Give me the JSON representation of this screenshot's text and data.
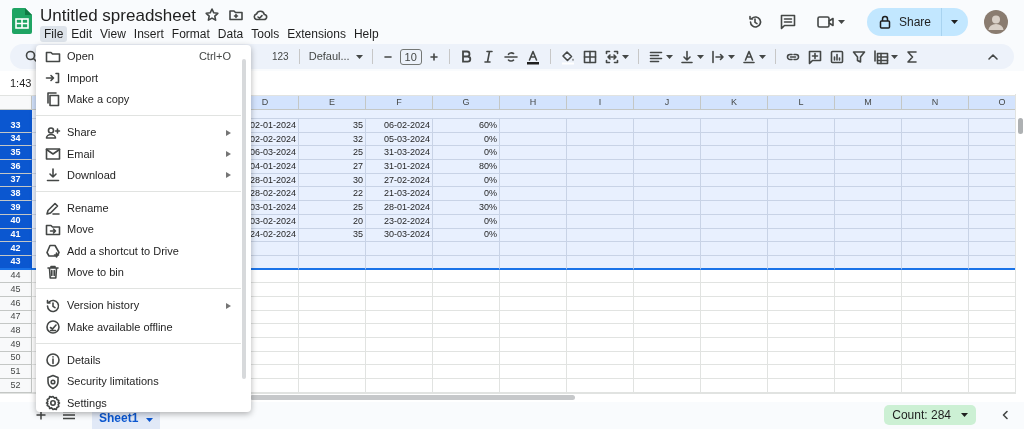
{
  "title": "Untitled spreadsheet",
  "menu_bar": [
    {
      "label": "File",
      "selected": true
    },
    {
      "label": "Edit",
      "selected": false
    },
    {
      "label": "View",
      "selected": false
    },
    {
      "label": "Insert",
      "selected": false
    },
    {
      "label": "Format",
      "selected": false
    },
    {
      "label": "Data",
      "selected": false
    },
    {
      "label": "Tools",
      "selected": false
    },
    {
      "label": "Extensions",
      "selected": false
    },
    {
      "label": "Help",
      "selected": false
    }
  ],
  "share_button": "Share",
  "toolbar": {
    "number_format": "123",
    "font": "Defaul...",
    "font_size": "10"
  },
  "name_box": "1:43",
  "grid": {
    "columns": [
      "D",
      "E",
      "F",
      "G",
      "H",
      "I",
      "J",
      "K",
      "L",
      "M",
      "N",
      "O"
    ],
    "rows": [
      {
        "number": "33",
        "selected": true,
        "cells": [
          "02-01-2024",
          "35",
          "06-02-2024",
          "60%"
        ]
      },
      {
        "number": "34",
        "selected": true,
        "cells": [
          "02-02-2024",
          "32",
          "05-03-2024",
          "0%"
        ]
      },
      {
        "number": "35",
        "selected": true,
        "cells": [
          "06-03-2024",
          "25",
          "31-03-2024",
          "0%"
        ]
      },
      {
        "number": "36",
        "selected": true,
        "cells": [
          "04-01-2024",
          "27",
          "31-01-2024",
          "80%"
        ]
      },
      {
        "number": "37",
        "selected": true,
        "cells": [
          "28-01-2024",
          "30",
          "27-02-2024",
          "0%"
        ]
      },
      {
        "number": "38",
        "selected": true,
        "cells": [
          "28-02-2024",
          "22",
          "21-03-2024",
          "0%"
        ]
      },
      {
        "number": "39",
        "selected": true,
        "cells": [
          "03-01-2024",
          "25",
          "28-01-2024",
          "30%"
        ]
      },
      {
        "number": "40",
        "selected": true,
        "cells": [
          "03-02-2024",
          "20",
          "23-02-2024",
          "0%"
        ]
      },
      {
        "number": "41",
        "selected": true,
        "cells": [
          "24-02-2024",
          "35",
          "30-03-2024",
          "0%"
        ]
      },
      {
        "number": "42",
        "selected": true
      },
      {
        "number": "43",
        "selected": true
      },
      {
        "number": "44",
        "selected": false
      },
      {
        "number": "45",
        "selected": false
      },
      {
        "number": "46",
        "selected": false
      },
      {
        "number": "47",
        "selected": false
      },
      {
        "number": "48",
        "selected": false
      },
      {
        "number": "49",
        "selected": false
      },
      {
        "number": "50",
        "selected": false
      },
      {
        "number": "51",
        "selected": false
      },
      {
        "number": "52",
        "selected": false
      }
    ]
  },
  "file_menu": [
    {
      "kind": "item",
      "label": "Open",
      "shortcut": "Ctrl+O",
      "submenu": false
    },
    {
      "kind": "item",
      "label": "Import",
      "submenu": false
    },
    {
      "kind": "item",
      "label": "Make a copy",
      "submenu": false
    },
    {
      "kind": "divider"
    },
    {
      "kind": "item",
      "label": "Share",
      "submenu": true
    },
    {
      "kind": "item",
      "label": "Email",
      "submenu": true
    },
    {
      "kind": "item",
      "label": "Download",
      "submenu": true
    },
    {
      "kind": "divider"
    },
    {
      "kind": "item",
      "label": "Rename",
      "submenu": false
    },
    {
      "kind": "item",
      "label": "Move",
      "submenu": false
    },
    {
      "kind": "item",
      "label": "Add a shortcut to Drive",
      "submenu": false
    },
    {
      "kind": "item",
      "label": "Move to bin",
      "submenu": false
    },
    {
      "kind": "divider"
    },
    {
      "kind": "item",
      "label": "Version history",
      "submenu": true
    },
    {
      "kind": "item",
      "label": "Make available offline",
      "submenu": false
    },
    {
      "kind": "divider"
    },
    {
      "kind": "item",
      "label": "Details",
      "submenu": false
    },
    {
      "kind": "item",
      "label": "Security limitations",
      "submenu": false
    },
    {
      "kind": "item",
      "label": "Settings",
      "submenu": false
    }
  ],
  "sheet_tabs": [
    {
      "label": "Sheet1",
      "selected": true
    }
  ],
  "summary": "Count: 284"
}
